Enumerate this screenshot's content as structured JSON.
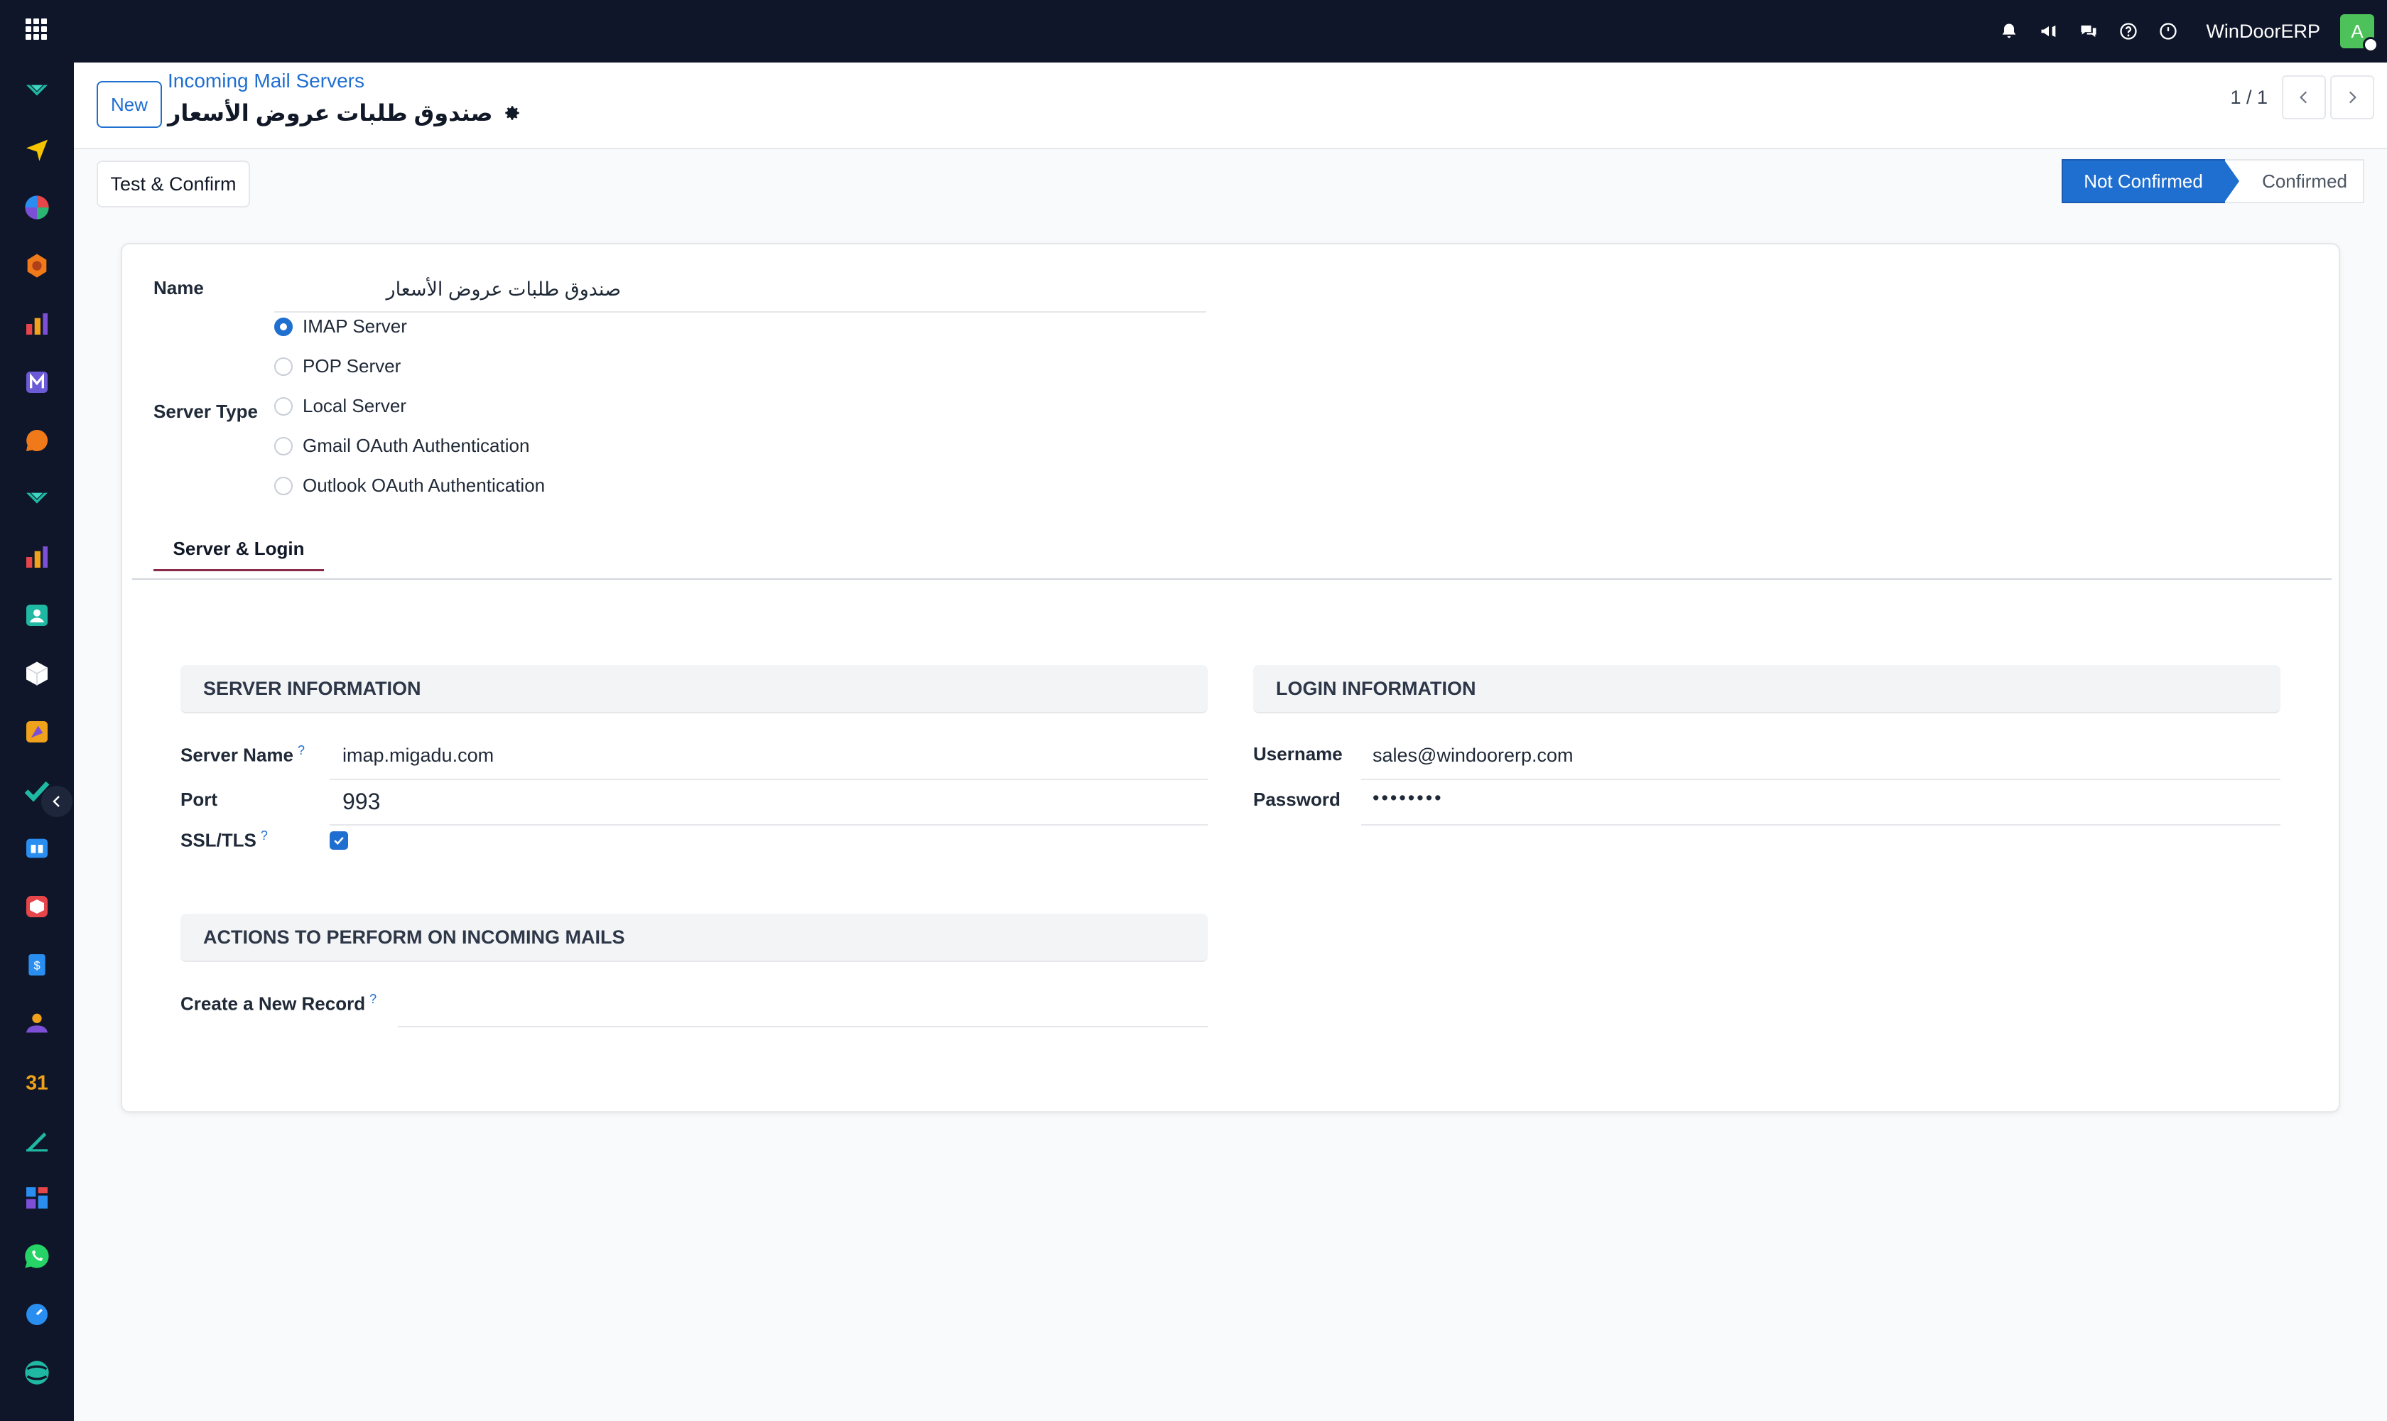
{
  "topbar": {
    "company": "WinDoorERP",
    "avatar_initial": "A",
    "icons": [
      "bell-icon",
      "megaphone-icon",
      "chat-icon",
      "help-icon",
      "clock-icon"
    ]
  },
  "sidebar": {
    "icons": [
      "discuss-icon",
      "send-icon",
      "dashboard-icon",
      "settings-app-icon",
      "reporting-icon",
      "mail-icon",
      "chat-bubble-icon",
      "discuss2-icon",
      "reporting2-icon",
      "contacts-icon",
      "inventory-icon",
      "apps-mix-icon",
      "todo-icon",
      "knowledge-icon",
      "package-icon",
      "billing-icon",
      "employees-icon",
      "calendar-icon",
      "sign-icon",
      "dashboards-icon",
      "whatsapp-icon",
      "timer-icon",
      "website-icon"
    ]
  },
  "control_panel": {
    "new_label": "New",
    "breadcrumb": "Incoming Mail Servers",
    "record_title": "صندوق طلبات عروض الأسعار",
    "pager": "1 / 1"
  },
  "actions": {
    "test_confirm_label": "Test & Confirm"
  },
  "status": {
    "stages": [
      "Not Confirmed",
      "Confirmed"
    ],
    "active": "Not Confirmed"
  },
  "form": {
    "name_label": "Name",
    "name_value": "صندوق طلبات عروض الأسعار",
    "server_type_label": "Server Type",
    "server_types": [
      {
        "label": "IMAP Server",
        "checked": true
      },
      {
        "label": "POP Server",
        "checked": false
      },
      {
        "label": "Local Server",
        "checked": false
      },
      {
        "label": "Gmail OAuth Authentication",
        "checked": false
      },
      {
        "label": "Outlook OAuth Authentication",
        "checked": false
      }
    ],
    "tab_label": "Server & Login",
    "server_info": {
      "title": "SERVER INFORMATION",
      "server_name_label": "Server Name",
      "server_name_value": "imap.migadu.com",
      "port_label": "Port",
      "port_value": "993",
      "ssl_label": "SSL/TLS",
      "ssl_checked": true
    },
    "login_info": {
      "title": "LOGIN INFORMATION",
      "username_label": "Username",
      "username_value": "sales@windoorerp.com",
      "password_label": "Password",
      "password_value": "••••••••"
    },
    "actions_group": {
      "title": "ACTIONS TO PERFORM ON INCOMING MAILS",
      "create_record_label": "Create a New Record",
      "create_record_value": ""
    },
    "help_mark": "?"
  },
  "colors": {
    "accent": "#1f6fd1",
    "navbar": "#0f1629",
    "tab_underline": "#8a2a4a"
  }
}
